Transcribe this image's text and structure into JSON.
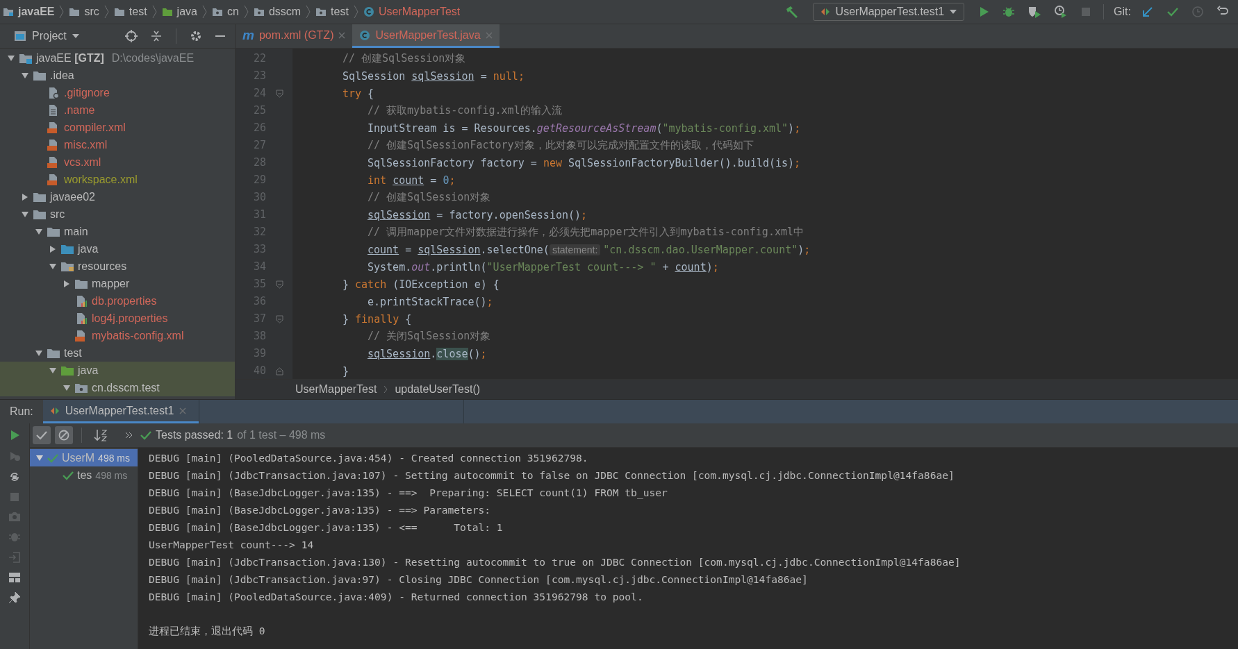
{
  "nav_bar": {
    "breadcrumbs": [
      {
        "label": "javaEE",
        "kind": "module",
        "bold": true
      },
      {
        "label": "src",
        "kind": "folder",
        "bold": false
      },
      {
        "label": "test",
        "kind": "folder",
        "bold": false
      },
      {
        "label": "java",
        "kind": "test-folder",
        "bold": false
      },
      {
        "label": "cn",
        "kind": "package",
        "bold": false
      },
      {
        "label": "dsscm",
        "kind": "package",
        "bold": false
      },
      {
        "label": "test",
        "kind": "package",
        "bold": false
      },
      {
        "label": "UserMapperTest",
        "kind": "class",
        "bold": false,
        "color": "#d1675a"
      }
    ],
    "run_config": "UserMapperTest.test1",
    "git_label": "Git:",
    "stop_disabled": true
  },
  "project": {
    "title": "Project",
    "tree": [
      {
        "label": "javaEE **[GTZ]**",
        "path": "D:\\codes\\javaEE",
        "kind": "module",
        "expanded": true,
        "children": [
          {
            "label": ".idea",
            "kind": "folder",
            "expanded": true,
            "children": [
              {
                "label": ".gitignore",
                "kind": "ignore-file",
                "color": "#d1675a"
              },
              {
                "label": ".name",
                "kind": "text-file",
                "color": "#d1675a"
              },
              {
                "label": "compiler.xml",
                "kind": "xml-file",
                "color": "#d1675a"
              },
              {
                "label": "misc.xml",
                "kind": "xml-file",
                "color": "#d1675a"
              },
              {
                "label": "vcs.xml",
                "kind": "xml-file",
                "color": "#d1675a"
              },
              {
                "label": "workspace.xml",
                "kind": "xml-file",
                "color": "#9a9b2e"
              }
            ]
          },
          {
            "label": "javaee02",
            "kind": "folder",
            "expanded": false
          },
          {
            "label": "src",
            "kind": "folder",
            "expanded": true,
            "children": [
              {
                "label": "main",
                "kind": "folder",
                "expanded": true,
                "children": [
                  {
                    "label": "java",
                    "kind": "source-folder",
                    "expanded": false
                  },
                  {
                    "label": "resources",
                    "kind": "resources-folder",
                    "expanded": true,
                    "children": [
                      {
                        "label": "mapper",
                        "kind": "folder",
                        "expanded": false
                      },
                      {
                        "label": "db.properties",
                        "kind": "properties-file",
                        "color": "#d1675a"
                      },
                      {
                        "label": "log4j.properties",
                        "kind": "properties-file",
                        "color": "#d1675a"
                      },
                      {
                        "label": "mybatis-config.xml",
                        "kind": "xml-file",
                        "color": "#d1675a"
                      }
                    ]
                  }
                ]
              },
              {
                "label": "test",
                "kind": "folder",
                "expanded": true,
                "children": [
                  {
                    "label": "java",
                    "kind": "test-folder",
                    "expanded": true,
                    "test_scope": true,
                    "children": [
                      {
                        "label": "cn.dsscm.test",
                        "kind": "package",
                        "expanded": true,
                        "test_scope": true
                      }
                    ]
                  }
                ]
              }
            ]
          }
        ]
      }
    ]
  },
  "editor": {
    "tabs": [
      {
        "label": "pom.xml (GTZ)",
        "kind": "maven",
        "glyph": "m",
        "color": "#d1675a",
        "selected": false
      },
      {
        "label": "UserMapperTest.java",
        "kind": "class",
        "color": "#d1675a",
        "selected": true
      }
    ],
    "lines": [
      {
        "number": "22",
        "tokens": [
          {
            "t": "// 创建SqlSession对象",
            "kind": "comment"
          }
        ]
      },
      {
        "number": "23",
        "tokens": [
          {
            "t": "SqlSession ",
            "kind": "plain"
          },
          {
            "t": "sqlSession",
            "kind": "var"
          },
          {
            "t": " = ",
            "kind": "plain"
          },
          {
            "t": "null",
            "kind": "keyword"
          },
          {
            "t": ";",
            "kind": "keyword"
          }
        ]
      },
      {
        "number": "24",
        "fold": {
          "kind": "start"
        },
        "tokens": [
          {
            "t": "try",
            "kind": "keyword"
          },
          {
            "t": " {",
            "kind": "plain"
          }
        ],
        "children": [
          {
            "number": "25",
            "tokens": [
              {
                "t": "// 获取mybatis-config.xml的输入流",
                "kind": "comment"
              }
            ]
          },
          {
            "number": "26",
            "tokens": [
              {
                "t": "InputStream is = Resources.",
                "kind": "plain"
              },
              {
                "t": "getResourceAsStream",
                "kind": "static"
              },
              {
                "t": "(",
                "kind": "plain"
              },
              {
                "t": "\"mybatis-config.xml\"",
                "kind": "string"
              },
              {
                "t": ")",
                "kind": "plain"
              },
              {
                "t": ";",
                "kind": "keyword"
              }
            ]
          },
          {
            "number": "27",
            "tokens": [
              {
                "t": "// 创建SqlSessionFactory对象，此对象可以完成对配置文件的读取，代码如下",
                "kind": "comment"
              }
            ]
          },
          {
            "number": "28",
            "tokens": [
              {
                "t": "SqlSessionFactory factory = ",
                "kind": "plain"
              },
              {
                "t": "new",
                "kind": "keyword"
              },
              {
                "t": " SqlSessionFactoryBuilder().build(is)",
                "kind": "plain"
              },
              {
                "t": ";",
                "kind": "keyword"
              }
            ]
          },
          {
            "number": "29",
            "tokens": [
              {
                "t": "int ",
                "kind": "keyword"
              },
              {
                "t": "count",
                "kind": "var"
              },
              {
                "t": " = ",
                "kind": "plain"
              },
              {
                "t": "0",
                "kind": "number"
              },
              {
                "t": ";",
                "kind": "keyword"
              }
            ]
          },
          {
            "number": "30",
            "tokens": [
              {
                "t": "// 创建SqlSession对象",
                "kind": "comment"
              }
            ]
          },
          {
            "number": "31",
            "tokens": [
              {
                "t": "sqlSession",
                "kind": "var"
              },
              {
                "t": " = factory.openSession()",
                "kind": "plain"
              },
              {
                "t": ";",
                "kind": "keyword"
              }
            ]
          },
          {
            "number": "32",
            "tokens": [
              {
                "t": "// 调用mapper文件对数据进行操作，必须先把mapper文件引入到mybatis-config.xml中",
                "kind": "comment"
              }
            ]
          },
          {
            "number": "33",
            "tokens": [
              {
                "t": "count",
                "kind": "var"
              },
              {
                "t": " = ",
                "kind": "plain"
              },
              {
                "t": "sqlSession",
                "kind": "var"
              },
              {
                "t": ".selectOne(",
                "kind": "plain"
              },
              {
                "t": "statement:",
                "kind": "hint"
              },
              {
                "t": "\"cn.dsscm.dao.UserMapper.count\"",
                "kind": "string"
              },
              {
                "t": ")",
                "kind": "plain"
              },
              {
                "t": ";",
                "kind": "keyword"
              }
            ]
          },
          {
            "number": "34",
            "tokens": [
              {
                "t": "System.",
                "kind": "plain"
              },
              {
                "t": "out",
                "kind": "static"
              },
              {
                "t": ".println(",
                "kind": "plain"
              },
              {
                "t": "\"UserMapperTest count---> \"",
                "kind": "string"
              },
              {
                "t": " + ",
                "kind": "plain"
              },
              {
                "t": "count",
                "kind": "var"
              },
              {
                "t": ")",
                "kind": "plain"
              },
              {
                "t": ";",
                "kind": "keyword"
              }
            ]
          }
        ]
      },
      {
        "number": "35",
        "fold": {
          "kind": "start"
        },
        "tokens": [
          {
            "t": "} ",
            "kind": "plain"
          },
          {
            "t": "catch",
            "kind": "keyword"
          },
          {
            "t": " (IOException e) {",
            "kind": "plain"
          }
        ],
        "children": [
          {
            "number": "36",
            "tokens": [
              {
                "t": "e.printStackTrace()",
                "kind": "plain"
              },
              {
                "t": ";",
                "kind": "keyword"
              }
            ]
          }
        ]
      },
      {
        "number": "37",
        "fold": {
          "kind": "start"
        },
        "tokens": [
          {
            "t": "} ",
            "kind": "plain"
          },
          {
            "t": "finally",
            "kind": "keyword"
          },
          {
            "t": " {",
            "kind": "plain"
          }
        ],
        "children": [
          {
            "number": "38",
            "tokens": [
              {
                "t": "// 关闭SqlSession对象",
                "kind": "comment"
              }
            ]
          },
          {
            "number": "39",
            "tokens": [
              {
                "t": "sqlSession",
                "kind": "var"
              },
              {
                "t": ".",
                "kind": "plain"
              },
              {
                "t": "close",
                "kind": "match"
              },
              {
                "t": "()",
                "kind": "plain"
              },
              {
                "t": ";",
                "kind": "keyword"
              }
            ]
          }
        ]
      },
      {
        "number": "40",
        "fold": {
          "kind": "end"
        },
        "tokens": [
          {
            "t": "}",
            "kind": "plain"
          }
        ]
      }
    ],
    "breadcrumbs": [
      "UserMapperTest",
      "updateUserTest()"
    ]
  },
  "run_panel": {
    "label": "Run:",
    "tab": "UserMapperTest.test1",
    "status": {
      "passed": "Tests passed: 1",
      "rest": "of 1 test – 498 ms"
    },
    "tests": [
      {
        "name": "UserM",
        "time": "498 ms",
        "passed": true,
        "selected": true,
        "expanded": true,
        "children": [
          {
            "name": "tes",
            "time": "498 ms",
            "passed": true,
            "selected": false
          }
        ]
      }
    ],
    "log": [
      "DEBUG [main] (PooledDataSource.java:454) - Created connection 351962798.",
      "DEBUG [main] (JdbcTransaction.java:107) - Setting autocommit to false on JDBC Connection [com.mysql.cj.jdbc.ConnectionImpl@14fa86ae]",
      "DEBUG [main] (BaseJdbcLogger.java:135) - ==>  Preparing: SELECT count(1) FROM tb_user",
      "DEBUG [main] (BaseJdbcLogger.java:135) - ==> Parameters: ",
      "DEBUG [main] (BaseJdbcLogger.java:135) - <==      Total: 1",
      "UserMapperTest count---> 14",
      "DEBUG [main] (JdbcTransaction.java:130) - Resetting autocommit to true on JDBC Connection [com.mysql.cj.jdbc.ConnectionImpl@14fa86ae]",
      "DEBUG [main] (JdbcTransaction.java:97) - Closing JDBC Connection [com.mysql.cj.jdbc.ConnectionImpl@14fa86ae]",
      "DEBUG [main] (PooledDataSource.java:409) - Returned connection 351962798 to pool."
    ],
    "exit_message": "进程已结束，退出代码 0"
  }
}
